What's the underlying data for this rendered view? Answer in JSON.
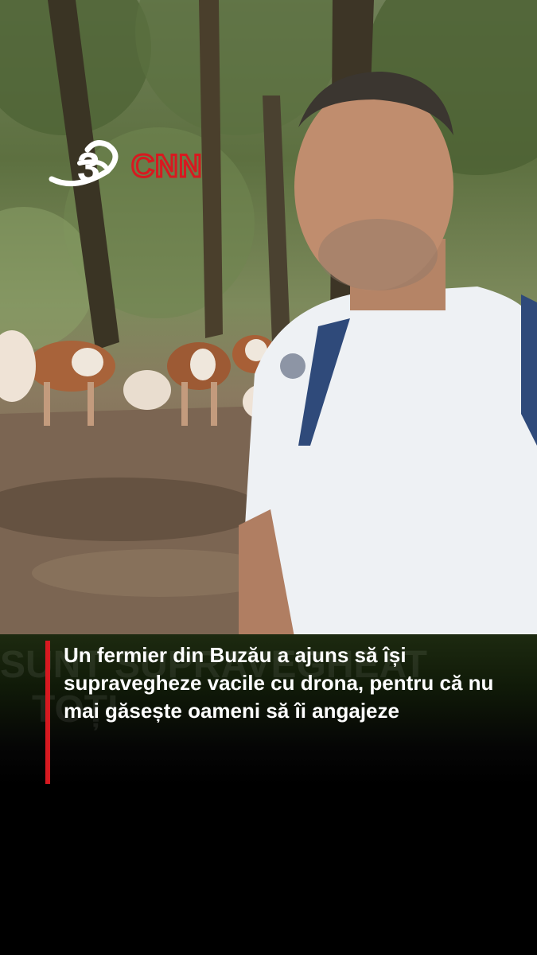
{
  "brand": {
    "logo_text": "CNN",
    "channel_mark": "3",
    "accent_color": "#d71920"
  },
  "caption": {
    "headline": "Un fermier din Buzău a ajuns să își supravegheze vacile cu drona, pentru că nu mai găsește oameni să îi angajeze"
  },
  "background_caption": {
    "text": "SUNT SUPRAVEGHEAT",
    "text_line2": "TOȚI"
  }
}
